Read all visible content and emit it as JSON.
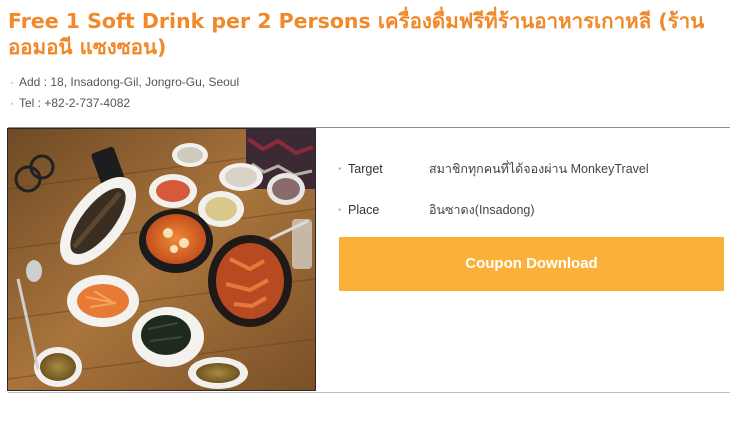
{
  "header": {
    "title": "Free 1 Soft Drink per 2 Persons เครื่องดื่มฟรีที่ร้านอาหารเกาหลี (ร้าน ออมอนี แซงซอน)"
  },
  "info": [
    {
      "bullet": "·",
      "text": "Add : 18, Insadong-Gil, Jongro-Gu, Seoul"
    },
    {
      "bullet": "·",
      "text": "Tel : +82-2-737-4082"
    }
  ],
  "photo": {
    "subject": "Korean food table"
  },
  "details": {
    "target": {
      "label": "Target",
      "value": "สมาชิกทุกคนที่ได้จองผ่าน MonkeyTravel"
    },
    "place": {
      "label": "Place",
      "value": "อินซาดง(Insadong)"
    }
  },
  "coupon": {
    "label": "Coupon Download"
  },
  "colors": {
    "accent": "#f1892a",
    "button": "#fbb03a",
    "button_text": "#ffffff"
  }
}
